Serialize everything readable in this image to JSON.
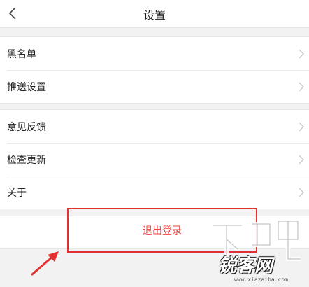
{
  "header": {
    "title": "设置",
    "back_icon": "chevron-left-icon"
  },
  "group1": {
    "items": [
      {
        "label": "黑名单"
      },
      {
        "label": "推送设置"
      }
    ]
  },
  "group2": {
    "items": [
      {
        "label": "意见反馈"
      },
      {
        "label": "检查更新"
      },
      {
        "label": "关于"
      }
    ]
  },
  "logout": {
    "label": "退出登录",
    "highlight_color": "#e53030"
  },
  "watermark": {
    "brand": "锐客网",
    "url": "www.xiazaiba.com"
  }
}
